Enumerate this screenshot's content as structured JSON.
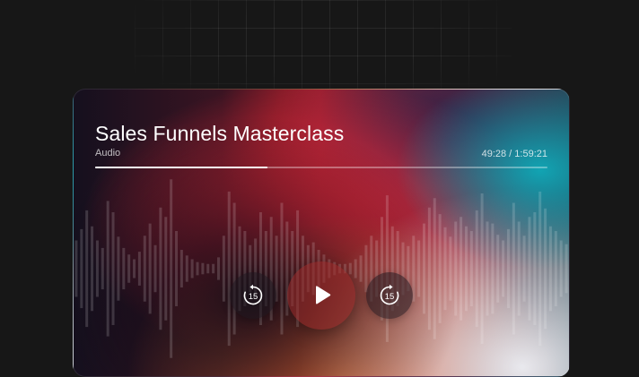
{
  "player": {
    "title": "Sales Funnels Masterclass",
    "subtitle": "Audio",
    "current_time": "49:28",
    "total_time": "1:59:21",
    "timecode": "49:28 / 1:59:21",
    "progress": 0.38,
    "controls": {
      "rewind_seconds": "15",
      "forward_seconds": "15",
      "play_icon": "play-icon",
      "rewind_icon": "rewind-15-icon",
      "forward_icon": "forward-15-icon"
    },
    "waveform_levels": [
      0.3,
      0.42,
      0.62,
      0.45,
      0.3,
      0.22,
      0.72,
      0.6,
      0.34,
      0.22,
      0.15,
      0.1,
      0.18,
      0.35,
      0.48,
      0.25,
      0.65,
      0.55,
      0.95,
      0.4,
      0.2,
      0.14,
      0.1,
      0.07,
      0.06,
      0.05,
      0.05,
      0.12,
      0.35,
      0.82,
      0.7,
      0.45,
      0.4,
      0.25,
      0.32,
      0.6,
      0.4,
      0.55,
      0.35,
      0.7,
      0.5,
      0.4,
      0.62,
      0.35,
      0.25,
      0.28,
      0.2,
      0.15,
      0.1,
      0.07,
      0.05,
      0.05,
      0.06,
      0.1,
      0.14,
      0.25,
      0.35,
      0.3,
      0.55,
      0.78,
      0.45,
      0.4,
      0.28,
      0.24,
      0.35,
      0.3,
      0.48,
      0.65,
      0.75,
      0.58,
      0.44,
      0.34,
      0.5,
      0.55,
      0.45,
      0.4,
      0.62,
      0.8,
      0.5,
      0.48,
      0.36,
      0.3,
      0.42,
      0.7,
      0.5,
      0.35,
      0.55,
      0.6,
      0.82,
      0.64,
      0.45,
      0.4,
      0.3,
      0.26
    ],
    "colors": {
      "page_background": "#171717",
      "accent_red": "#f22a3a",
      "accent_teal": "#11a4b3",
      "text": "#ffffff"
    }
  }
}
